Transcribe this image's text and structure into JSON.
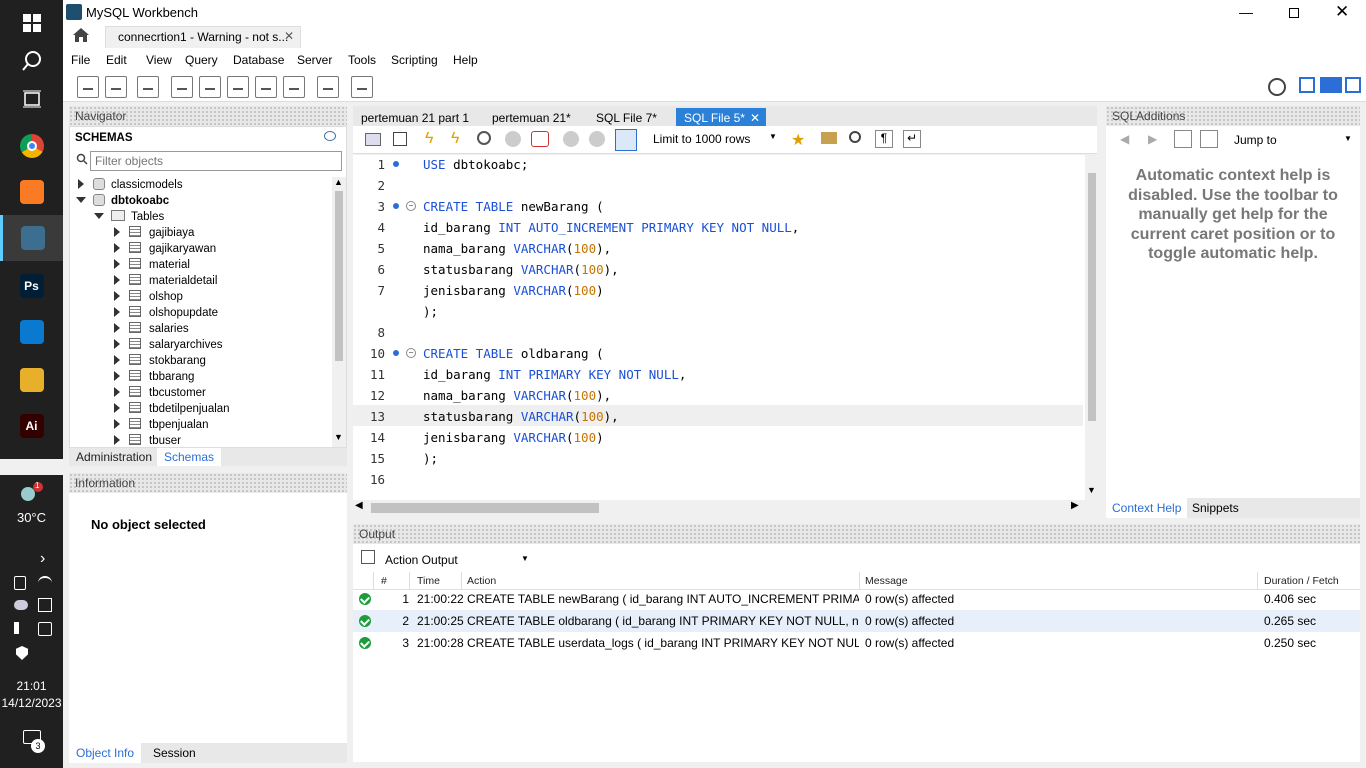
{
  "window": {
    "title": "MySQL Workbench",
    "connection_tab": "connecrtion1 - Warning - not s..."
  },
  "menu": [
    "File",
    "Edit",
    "View",
    "Query",
    "Database",
    "Server",
    "Tools",
    "Scripting",
    "Help"
  ],
  "navigator": {
    "title": "Navigator",
    "schemas_label": "SCHEMAS",
    "filter_placeholder": "Filter objects",
    "schemas": [
      "classicmodels",
      "dbtokoabc"
    ],
    "tables_label": "Tables",
    "tables": [
      "gajibiaya",
      "gajikaryawan",
      "material",
      "materialdetail",
      "olshop",
      "olshopupdate",
      "salaries",
      "salaryarchives",
      "stokbarang",
      "tbbarang",
      "tbcustomer",
      "tbdetilpenjualan",
      "tbpenjualan",
      "tbuser"
    ],
    "tabs": [
      "Administration",
      "Schemas"
    ]
  },
  "information": {
    "title": "Information",
    "text": "No object selected",
    "tabs": [
      "Object Info",
      "Session"
    ]
  },
  "editor": {
    "tabs": [
      "pertemuan 21 part 1",
      "pertemuan 21*",
      "SQL File 7*",
      "SQL File 5*"
    ],
    "limit": "Limit to 1000 rows",
    "lines": [
      {
        "n": "1",
        "tokens": [
          [
            "kw",
            "USE"
          ],
          [
            "t",
            " dbtokoabc;"
          ]
        ]
      },
      {
        "n": "2",
        "tokens": []
      },
      {
        "n": "3",
        "tokens": [
          [
            "kw",
            "CREATE TABLE"
          ],
          [
            "t",
            " newBarang ("
          ]
        ]
      },
      {
        "n": "4",
        "tokens": [
          [
            "t",
            "id_barang "
          ],
          [
            "kw",
            "INT AUTO_INCREMENT PRIMARY KEY NOT NULL"
          ],
          [
            "t",
            ","
          ]
        ]
      },
      {
        "n": "5",
        "tokens": [
          [
            "t",
            "nama_barang "
          ],
          [
            "kw",
            "VARCHAR"
          ],
          [
            "t",
            "("
          ],
          [
            "num",
            "100"
          ],
          [
            "t",
            "),"
          ]
        ]
      },
      {
        "n": "6",
        "tokens": [
          [
            "t",
            "statusbarang "
          ],
          [
            "kw",
            "VARCHAR"
          ],
          [
            "t",
            "("
          ],
          [
            "num",
            "100"
          ],
          [
            "t",
            "),"
          ]
        ]
      },
      {
        "n": "7",
        "tokens": [
          [
            "t",
            "jenisbarang "
          ],
          [
            "kw",
            "VARCHAR"
          ],
          [
            "t",
            "("
          ],
          [
            "num",
            "100"
          ],
          [
            "t",
            ")"
          ]
        ]
      },
      {
        "n": "",
        "tokens": [
          [
            "t",
            ");"
          ]
        ]
      },
      {
        "n": "8",
        "tokens": []
      },
      {
        "n": "10",
        "tokens": [
          [
            "kw",
            "CREATE TABLE"
          ],
          [
            "t",
            " oldbarang ("
          ]
        ]
      },
      {
        "n": "11",
        "tokens": [
          [
            "t",
            "id_barang "
          ],
          [
            "kw",
            "INT PRIMARY KEY NOT NULL"
          ],
          [
            "t",
            ","
          ]
        ]
      },
      {
        "n": "12",
        "tokens": [
          [
            "t",
            "nama_barang "
          ],
          [
            "kw",
            "VARCHAR"
          ],
          [
            "t",
            "("
          ],
          [
            "num",
            "100"
          ],
          [
            "t",
            "),"
          ]
        ]
      },
      {
        "n": "13",
        "tokens": [
          [
            "t",
            "statusbarang "
          ],
          [
            "kw",
            "VARCHAR"
          ],
          [
            "t",
            "("
          ],
          [
            "num",
            "100"
          ],
          [
            "t",
            "),"
          ]
        ]
      },
      {
        "n": "14",
        "tokens": [
          [
            "t",
            "jenisbarang "
          ],
          [
            "kw",
            "VARCHAR"
          ],
          [
            "t",
            "("
          ],
          [
            "num",
            "100"
          ],
          [
            "t",
            ")"
          ]
        ]
      },
      {
        "n": "15",
        "tokens": [
          [
            "t",
            ");"
          ]
        ]
      },
      {
        "n": "16",
        "tokens": []
      }
    ]
  },
  "sqladditions": {
    "title": "SQLAdditions",
    "jump": "Jump to",
    "help": "Automatic context help is disabled. Use the toolbar to manually get help for the current caret position or to toggle automatic help.",
    "tabs": [
      "Context Help",
      "Snippets"
    ]
  },
  "output": {
    "title": "Output",
    "mode": "Action Output",
    "headers": [
      "#",
      "Time",
      "Action",
      "Message",
      "Duration / Fetch"
    ],
    "rows": [
      [
        "1",
        "21:00:22",
        "CREATE TABLE newBarang ( id_barang INT AUTO_INCREMENT PRIMARY K...",
        "0 row(s) affected",
        "0.406 sec"
      ],
      [
        "2",
        "21:00:25",
        "CREATE TABLE oldbarang ( id_barang INT PRIMARY KEY NOT NULL, nama_...",
        "0 row(s) affected",
        "0.265 sec"
      ],
      [
        "3",
        "21:00:28",
        "CREATE TABLE userdata_logs ( id_barang INT PRIMARY KEY NOT NULL, ter...",
        "0 row(s) affected",
        "0.250 sec"
      ]
    ]
  },
  "taskbar": {
    "temp": "30°C",
    "time": "21:01",
    "date": "14/12/2023",
    "notif": "3",
    "weather_badge": "1",
    "apps": [
      {
        "name": "chrome-icon",
        "color": "#db4437"
      },
      {
        "name": "xampp-icon",
        "color": "#fb7a24"
      },
      {
        "name": "workbench-icon",
        "color": "#3c6e8f"
      },
      {
        "name": "photoshop-icon",
        "color": "#001e36",
        "label": "Ps"
      },
      {
        "name": "vscode-icon",
        "color": "#0a7ad1"
      },
      {
        "name": "folder-icon",
        "color": "#e8b02a"
      },
      {
        "name": "illustrator-icon",
        "color": "#330000",
        "label": "Ai"
      }
    ]
  }
}
